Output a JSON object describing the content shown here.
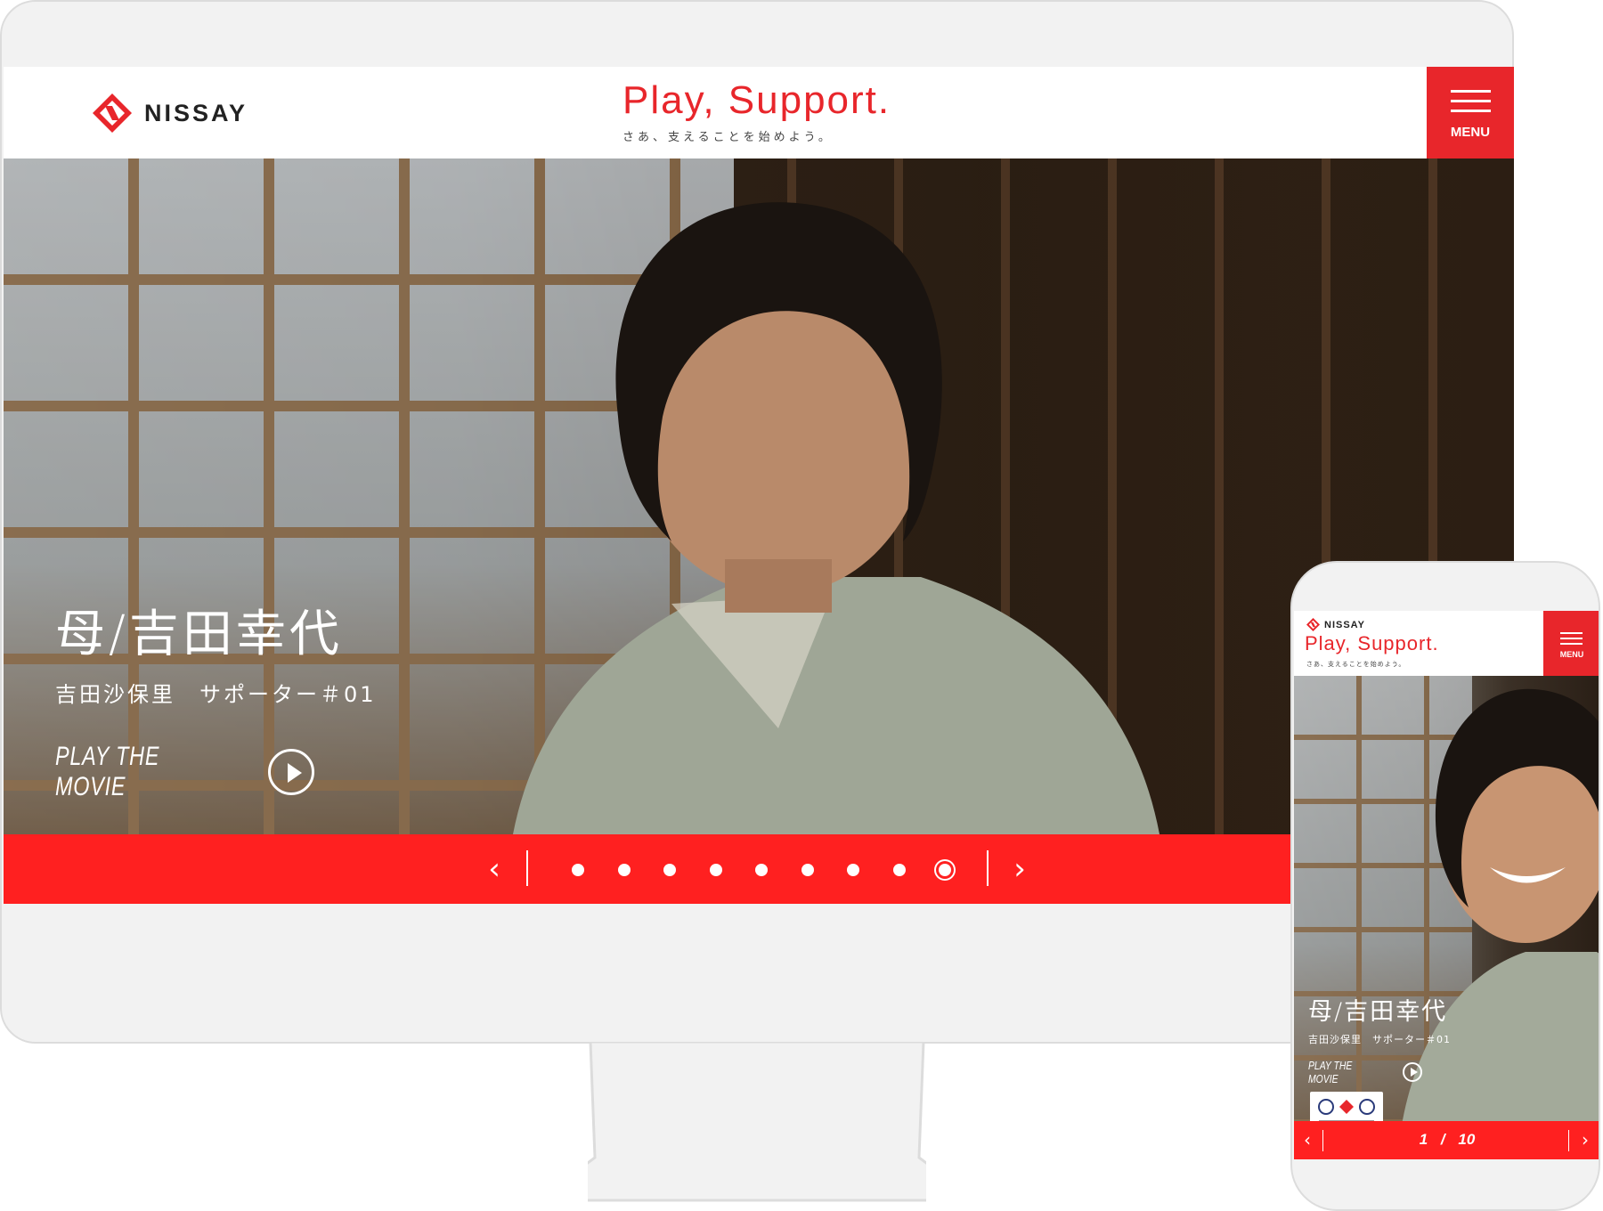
{
  "brand": {
    "logo_text": "NISSAY",
    "tagline_main": "Play, Support.",
    "tagline_sub": "さあ、支えることを始めよう。",
    "accent_color": "#e8262b",
    "pager_color": "#ff2020"
  },
  "header": {
    "menu_label": "MENU",
    "menu_icon": "hamburger-icon"
  },
  "hero": {
    "title": "母/吉田幸代",
    "subtitle": "吉田沙保里　サポーター＃01",
    "play_label": "PLAY THE MOVIE",
    "play_icon": "play-circle-icon"
  },
  "desktop_pager": {
    "prev_icon": "chevron-left-icon",
    "next_icon": "chevron-right-icon",
    "slide_count": 9,
    "active_index": 8
  },
  "mobile_pager": {
    "current": "1",
    "separator": "/",
    "total": "10",
    "prev_icon": "chevron-left-icon",
    "next_icon": "chevron-right-icon"
  }
}
